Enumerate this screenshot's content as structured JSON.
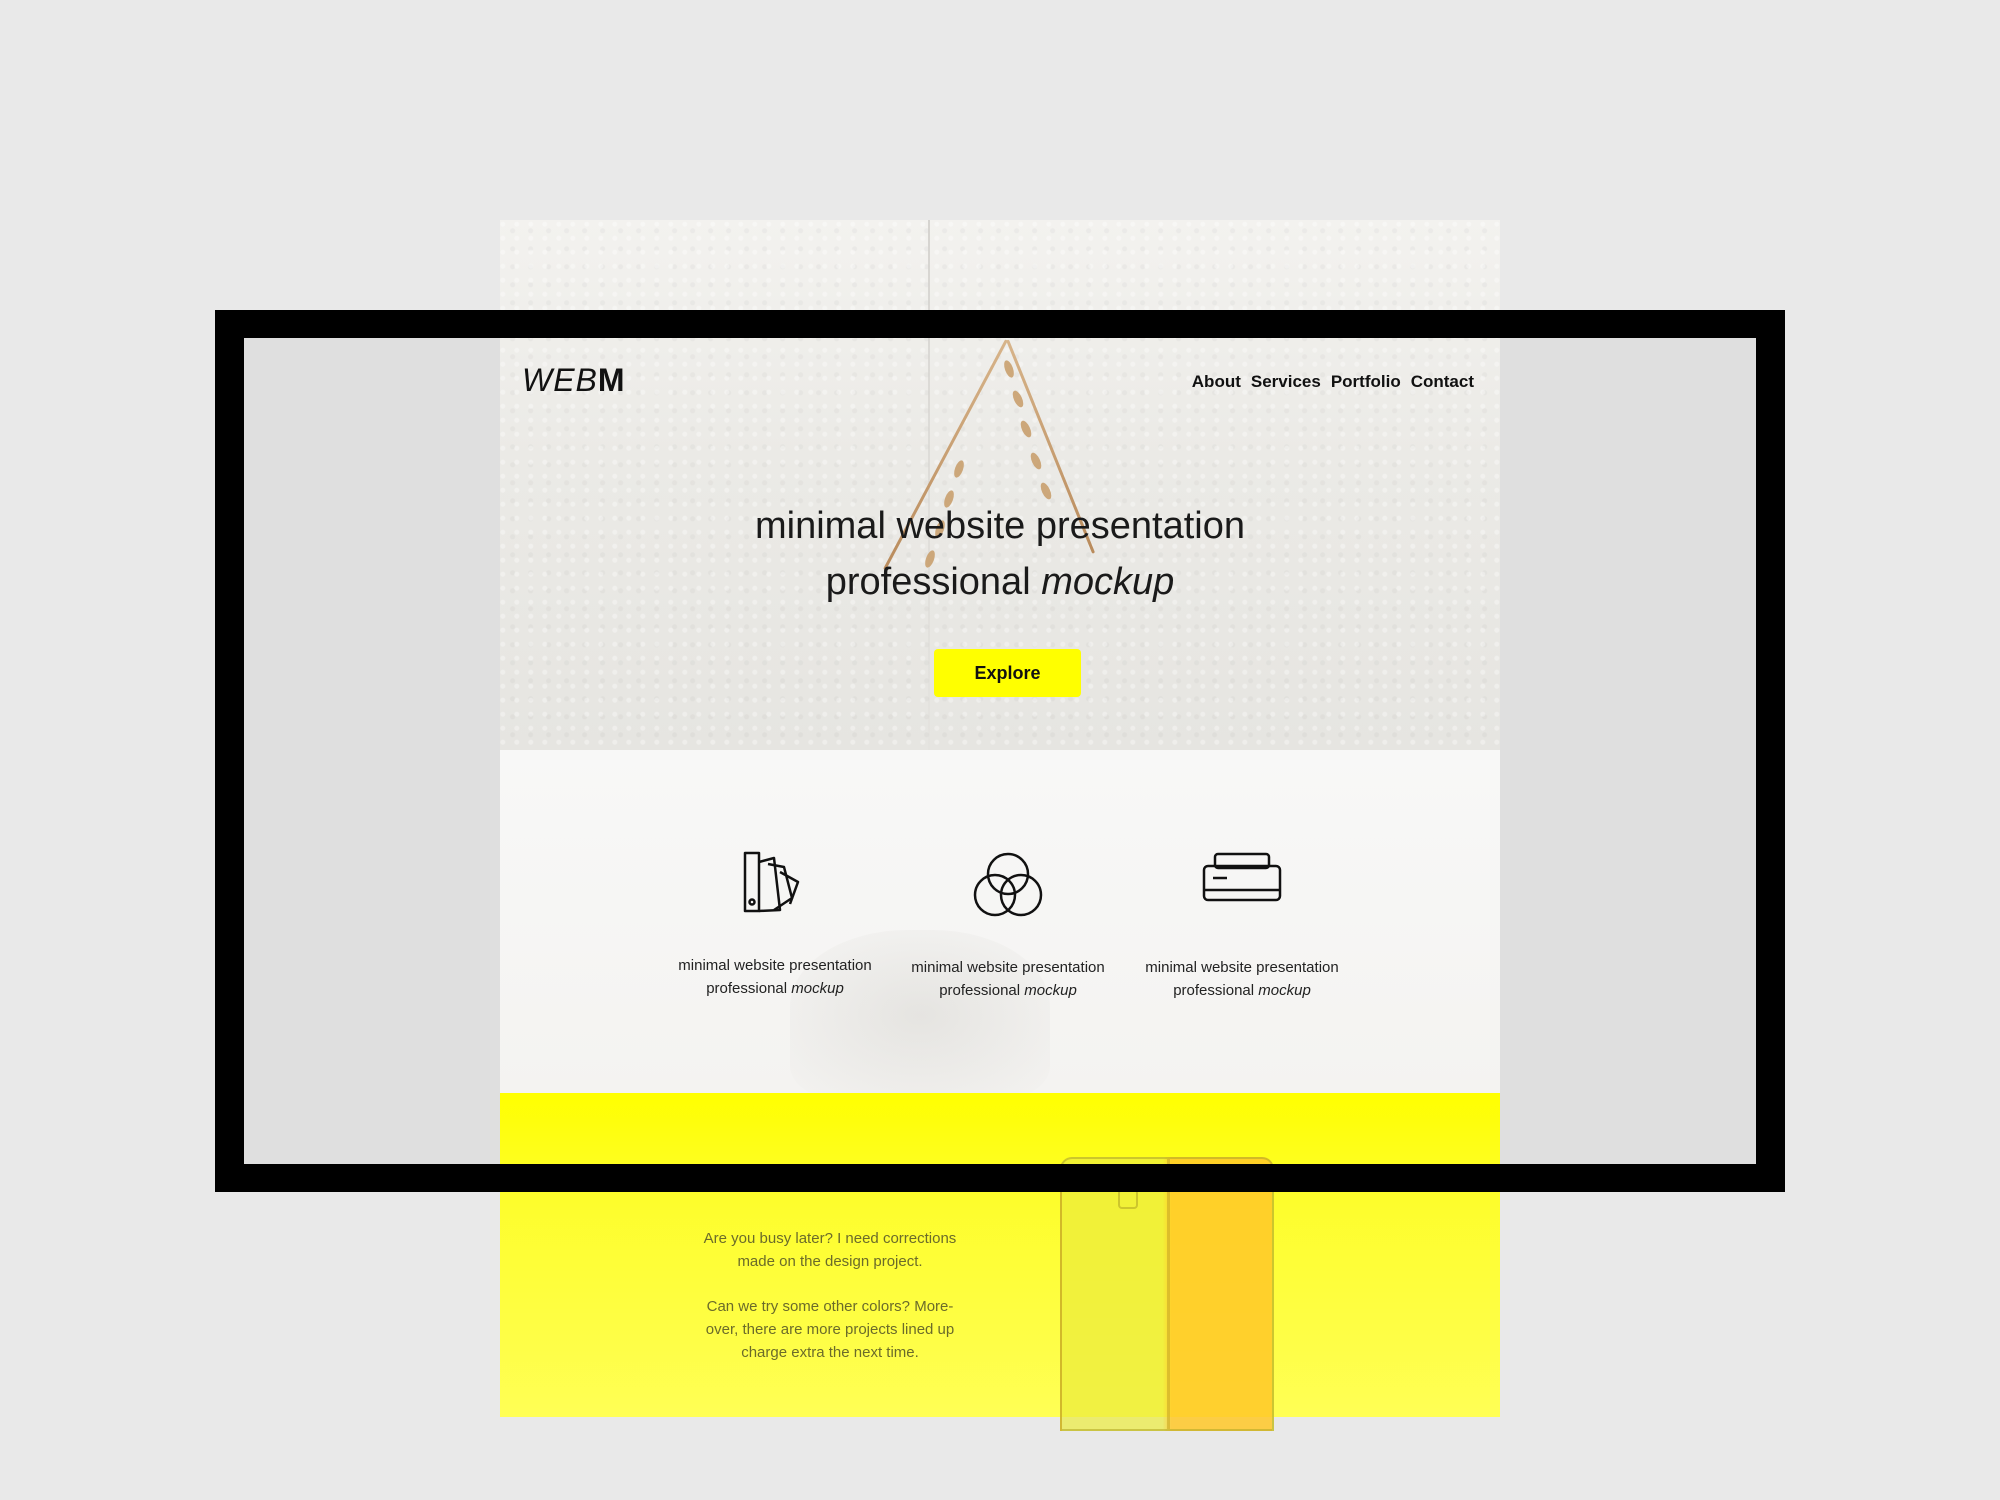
{
  "site": {
    "logo_light": "WEB",
    "logo_bold": "M"
  },
  "nav": {
    "items": [
      "About",
      "Services",
      "Portfolio",
      "Contact"
    ]
  },
  "hero": {
    "title_line1": "minimal website presentation",
    "title_line2_plain": "professional ",
    "title_line2_em": "mockup",
    "button_label": "Explore",
    "button_color": "#ffff00"
  },
  "services": [
    {
      "icon": "swatch-fan-icon",
      "line1": "minimal website presentation",
      "line2_plain": "professional ",
      "line2_em": "mockup"
    },
    {
      "icon": "overlapping-circles-icon",
      "line1": "minimal website presentation",
      "line2_plain": "professional ",
      "line2_em": "mockup"
    },
    {
      "icon": "printer-icon",
      "line1": "minimal website presentation",
      "line2_plain": "professional ",
      "line2_em": "mockup"
    }
  ],
  "yellow_section": {
    "message1": "Are you busy later? I need corrections made on the design project.",
    "message2": "Can we try some other colors? More-over, there are more projects lined up charge extra the next time.",
    "accent": "#ffff00"
  }
}
